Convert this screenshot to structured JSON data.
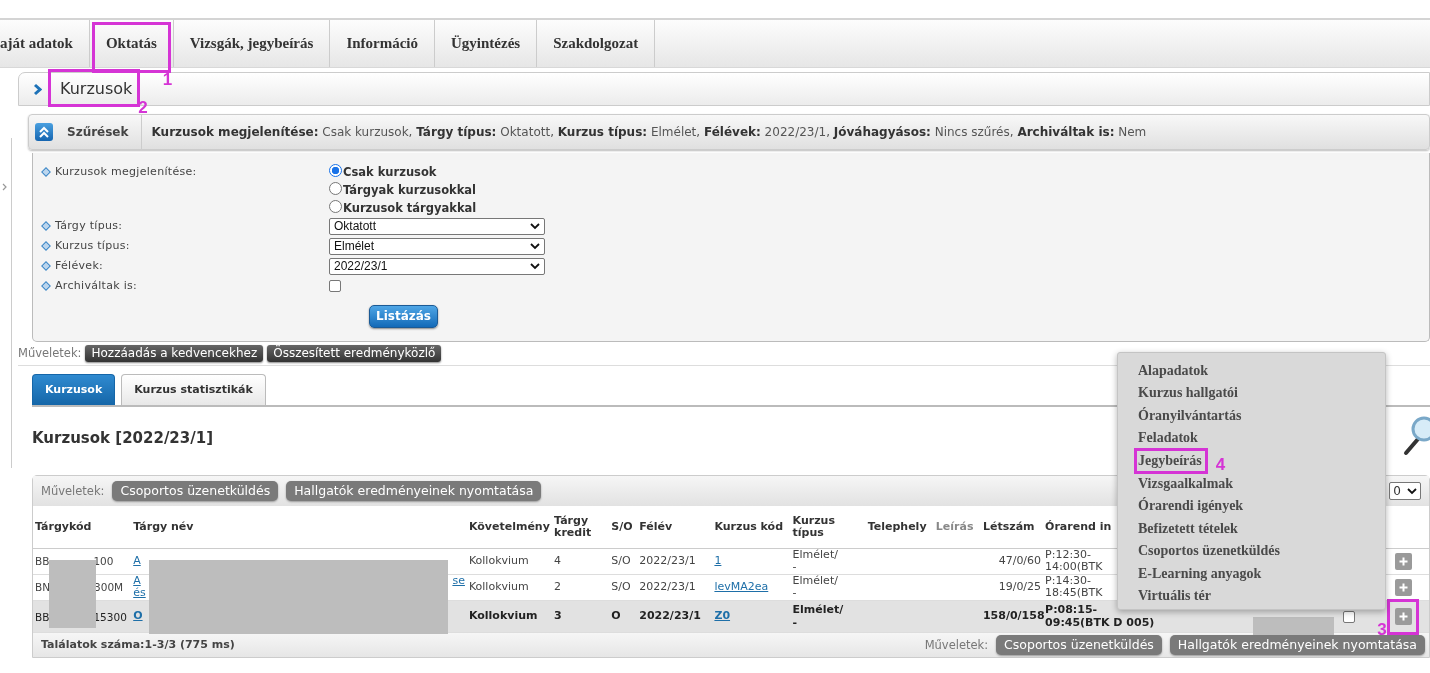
{
  "top_nav": [
    {
      "label": "aját adatok"
    },
    {
      "label": "Oktatás",
      "annotation": "1"
    },
    {
      "label": "Vizsgák, jegybeírás"
    },
    {
      "label": "Információ"
    },
    {
      "label": "Ügyintézés"
    },
    {
      "label": "Szakdolgozat"
    }
  ],
  "page_header": {
    "title": "Kurzusok",
    "annotation": "2"
  },
  "filter_bar": {
    "label": "Szűrések",
    "summary": "**Kurzusok megjelenítése:** Csak kurzusok, **Tárgy típus:** Oktatott, **Kurzus típus:** Elmélet, **Félévek:** 2022/23/1, **Jóváhagyásos:** Nincs szűrés, **Archiváltak is:** Nem"
  },
  "filter_form": {
    "fields": [
      {
        "kind": "radio",
        "label": "Kurzusok megjelenítése:",
        "options": [
          {
            "label": "Csak kurzusok",
            "selected": true
          },
          {
            "label": "Tárgyak kurzusokkal",
            "selected": false
          },
          {
            "label": "Kurzusok tárgyakkal",
            "selected": false
          }
        ]
      },
      {
        "kind": "select",
        "label": "Tárgy típus:",
        "value": "Oktatott"
      },
      {
        "kind": "select",
        "label": "Kurzus típus:",
        "value": "Elmélet"
      },
      {
        "kind": "select",
        "label": "Félévek:",
        "value": "2022/23/1"
      },
      {
        "kind": "checkbox",
        "label": "Archiváltak is:",
        "checked": false
      }
    ],
    "submit": "Listázás"
  },
  "actions": {
    "label": "Műveletek:",
    "buttons": [
      "Hozzáadás a kedvencekhez",
      "Összesített eredményközlő"
    ]
  },
  "tabs": [
    {
      "label": "Kurzusok",
      "selected": true
    },
    {
      "label": "Kurzus statisztikák",
      "selected": false
    }
  ],
  "list_title": "Kurzusok [2022/23/1]",
  "table": {
    "actions": {
      "label": "Műveletek:",
      "buttons": [
        "Csoportos üzenetküldés",
        "Hallgatók eredményeinek nyomtatása"
      ]
    },
    "page_size": "0",
    "columns": [
      {
        "label": "Tárgykód",
        "dimmed": false
      },
      {
        "label": "Tárgy név",
        "dimmed": false
      },
      {
        "label": "Követelmény",
        "dimmed": false
      },
      {
        "label": "Tárgy kredit",
        "dimmed": false
      },
      {
        "label": "S/O",
        "dimmed": false
      },
      {
        "label": "Félév",
        "dimmed": false
      },
      {
        "label": "Kurzus kód",
        "dimmed": false
      },
      {
        "label": "Kurzus típus",
        "dimmed": false
      },
      {
        "label": "Telephely",
        "dimmed": false
      },
      {
        "label": "Leírás",
        "dimmed": true
      },
      {
        "label": "Létszám",
        "dimmed": false
      },
      {
        "label": "Órarend in",
        "dimmed": false
      }
    ],
    "rows": [
      {
        "selected": false,
        "code_parts": [
          "BB",
          "100"
        ],
        "name_parts": [
          "A"
        ],
        "requirement": "Kollokvium",
        "credit": "4",
        "so": "S/O",
        "semester": "2022/23/1",
        "course_code": "1",
        "course_type": [
          "Elmélet/",
          "-"
        ],
        "headcount": "47/0/60",
        "schedule": [
          "P:12:30-",
          "14:00(BTK"
        ]
      },
      {
        "selected": false,
        "code_parts": [
          "BN",
          "300M"
        ],
        "name_parts": [
          "A",
          "se",
          "és"
        ],
        "requirement": "Kollokvium",
        "credit": "2",
        "so": "S/O",
        "semester": "2022/23/1",
        "course_code": "levMA2ea",
        "course_type": [
          "Elmélet/",
          "-"
        ],
        "headcount": "19/0/25",
        "schedule": [
          "P:14:30-",
          "18:45(BTK"
        ]
      },
      {
        "selected": true,
        "checked": false,
        "annotation": "3",
        "code_parts": [
          "BB",
          "15300"
        ],
        "name_parts": [
          "O"
        ],
        "requirement": "Kollokvium",
        "credit": "3",
        "so": "O",
        "semester": "2022/23/1",
        "course_code": "Z0",
        "course_type": [
          "Elmélet/",
          "-"
        ],
        "headcount": "158/0/158",
        "schedule": [
          "P:08:15-",
          "09:45(BTK D 005)"
        ]
      }
    ],
    "result_count": "Találatok száma:1-3/3 (775 ms)",
    "footer_actions": {
      "label": "Műveletek:",
      "buttons": [
        "Csoportos üzenetküldés",
        "Hallgatók eredményeinek nyomtatása"
      ]
    }
  },
  "context_menu": {
    "items": [
      {
        "label": "Alapadatok"
      },
      {
        "label": "Kurzus hallgatói"
      },
      {
        "label": "Óranyilvántartás"
      },
      {
        "label": "Feladatok"
      },
      {
        "label": "Jegybeírás",
        "annotation": "4"
      },
      {
        "label": "Vizsgaalkalmak"
      },
      {
        "label": "Órarendi igények"
      },
      {
        "label": "Befizetett tételek"
      },
      {
        "label": "Csoportos üzenetküldés"
      },
      {
        "label": "E-Learning anyagok"
      },
      {
        "label": "Virtuális tér"
      }
    ]
  }
}
